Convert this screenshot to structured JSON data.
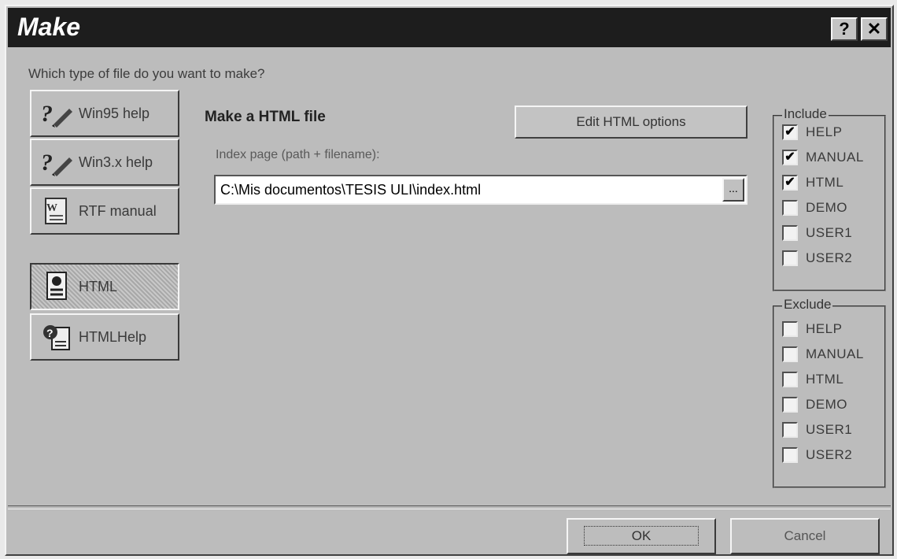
{
  "window": {
    "title": "Make",
    "help_label": "?",
    "close_label": "✕"
  },
  "prompt": "Which type of file do you want to make?",
  "file_types": [
    {
      "label": "Win95 help",
      "icon": "help-pen-icon",
      "active": false
    },
    {
      "label": "Win3.x help",
      "icon": "help-pen-icon",
      "active": false
    },
    {
      "label": "RTF manual",
      "icon": "word-document-icon",
      "active": false
    },
    {
      "label": "HTML",
      "icon": "html-document-icon",
      "active": true
    },
    {
      "label": "HTMLHelp",
      "icon": "html-help-icon",
      "active": false
    }
  ],
  "section_title": "Make a HTML file",
  "edit_html_options_label": "Edit HTML options",
  "index_page": {
    "label": "Index page (path + filename):",
    "value": "C:\\Mis documentos\\TESIS ULI\\index.html",
    "browse_label": "..."
  },
  "include": {
    "title": "Include",
    "items": [
      {
        "label": "HELP",
        "checked": true
      },
      {
        "label": "MANUAL",
        "checked": true
      },
      {
        "label": "HTML",
        "checked": true
      },
      {
        "label": "DEMO",
        "checked": false
      },
      {
        "label": "USER1",
        "checked": false
      },
      {
        "label": "USER2",
        "checked": false
      }
    ]
  },
  "exclude": {
    "title": "Exclude",
    "items": [
      {
        "label": "HELP",
        "checked": false
      },
      {
        "label": "MANUAL",
        "checked": false
      },
      {
        "label": "HTML",
        "checked": false
      },
      {
        "label": "DEMO",
        "checked": false
      },
      {
        "label": "USER1",
        "checked": false
      },
      {
        "label": "USER2",
        "checked": false
      }
    ]
  },
  "footer": {
    "ok_label": "OK",
    "cancel_label": "Cancel"
  }
}
